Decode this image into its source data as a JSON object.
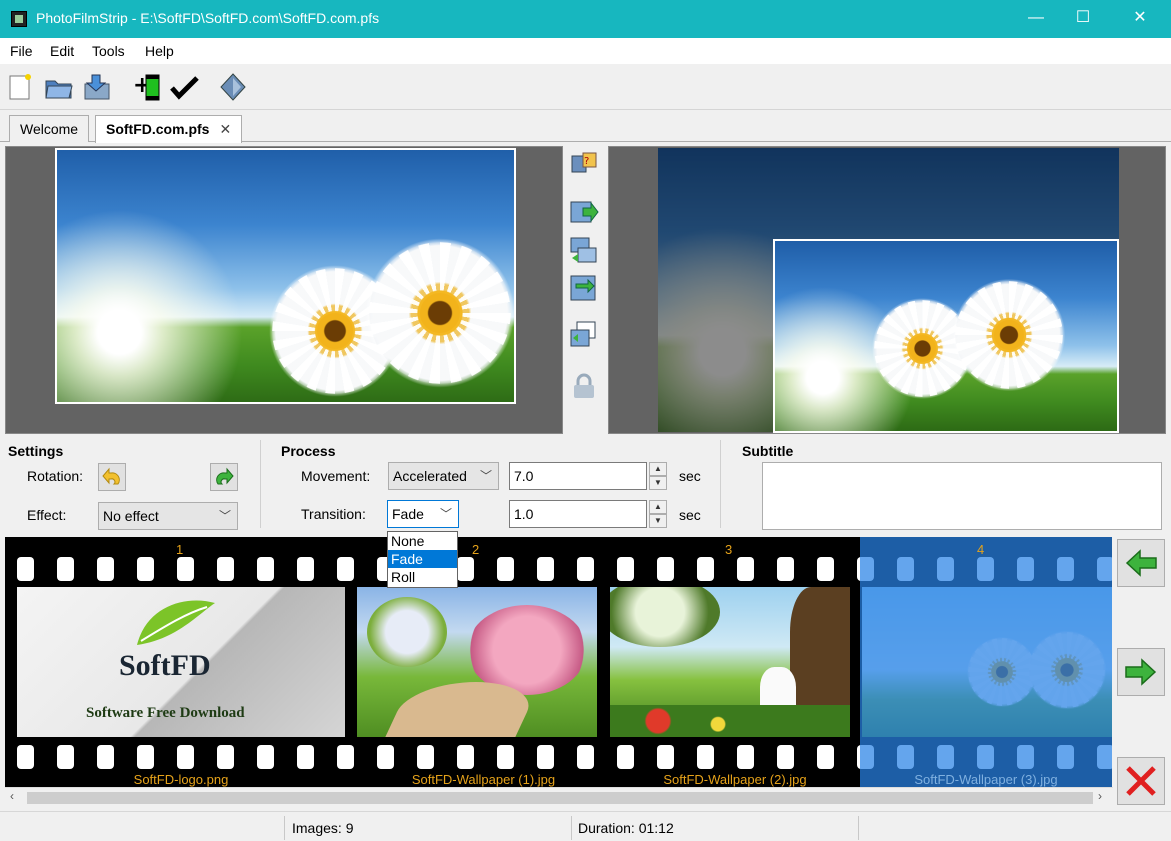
{
  "window": {
    "title": "PhotoFilmStrip - E:\\SoftFD\\SoftFD.com\\SoftFD.com.pfs",
    "minimize": "—",
    "maximize": "☐",
    "close": "✕"
  },
  "menu": [
    "File",
    "Edit",
    "Tools",
    "Help"
  ],
  "toolbar": {
    "icons": [
      "new-project-icon",
      "open-project-icon",
      "save-project-icon",
      "import-pictures-icon",
      "render-icon",
      "preview-icon"
    ]
  },
  "tabs": [
    {
      "label": "Welcome"
    },
    {
      "label": "SoftFD.com.pfs",
      "close": "✕"
    }
  ],
  "editor_icons": [
    "set-start-end-icon",
    "move-right-icon",
    "copy-icon",
    "swap-icon",
    "subtitle-copy-icon",
    "lock-icon"
  ],
  "settings": {
    "title": "Settings",
    "rotation_label": "Rotation:",
    "effect_label": "Effect:",
    "effect_value": "No effect"
  },
  "process": {
    "title": "Process",
    "movement_label": "Movement:",
    "movement_value": "Accelerated",
    "movement_duration": "7.0",
    "transition_label": "Transition:",
    "transition_value": "Fade",
    "transition_duration": "1.0",
    "unit": "sec",
    "transition_options": [
      "None",
      "Fade",
      "Roll"
    ],
    "transition_selected": "Fade"
  },
  "subtitle": {
    "title": "Subtitle",
    "value": ""
  },
  "filmstrip": {
    "frames": [
      {
        "number": "1",
        "filename": "SoftFD-logo.png",
        "logo_text": "SoftFD",
        "logo_tagline": "Software Free Download"
      },
      {
        "number": "2",
        "filename": "SoftFD-Wallpaper (1).jpg"
      },
      {
        "number": "3",
        "filename": "SoftFD-Wallpaper (2).jpg"
      },
      {
        "number": "4",
        "filename": "SoftFD-Wallpaper (3).jpg",
        "selected": true
      }
    ]
  },
  "side_buttons": [
    "move-left-icon",
    "move-right-icon",
    "delete-icon"
  ],
  "status": {
    "images": "Images: 9",
    "duration": "Duration: 01:12"
  },
  "colors": {
    "titlebar": "#17b7bf",
    "filmstrip_text": "#e5a21a",
    "selection": "#0078d7"
  }
}
